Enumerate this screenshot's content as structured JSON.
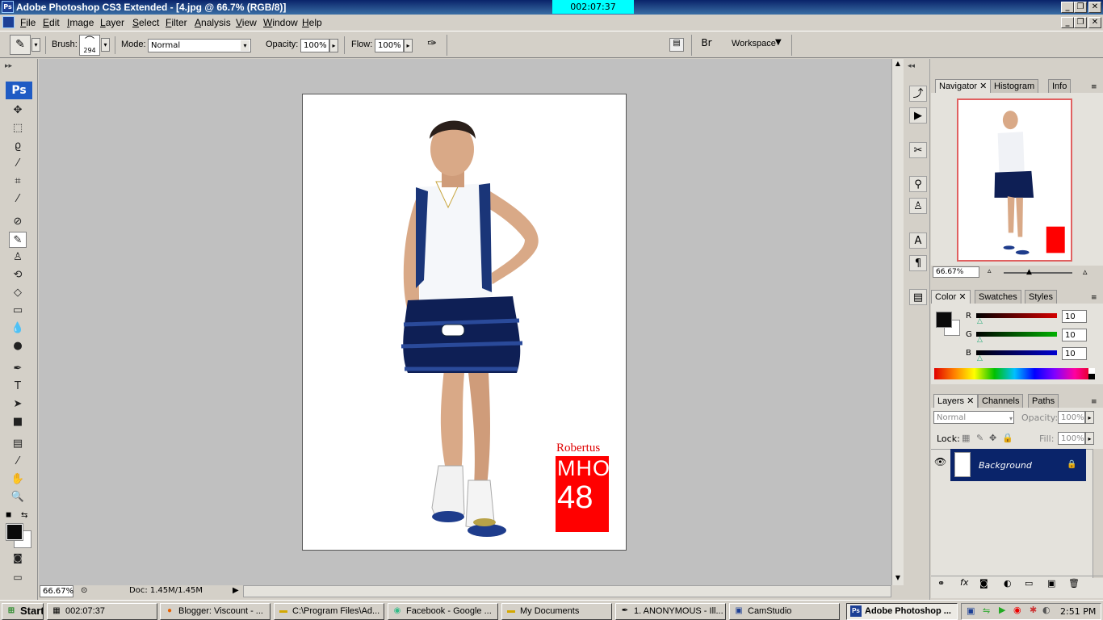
{
  "window": {
    "title": "Adobe Photoshop CS3 Extended - [4.jpg @ 66.7% (RGB/8)]",
    "timer": "002:07:37",
    "app_icon": "Ps"
  },
  "menu": [
    "File",
    "Edit",
    "Image",
    "Layer",
    "Select",
    "Filter",
    "Analysis",
    "View",
    "Window",
    "Help"
  ],
  "options": {
    "brush_label": "Brush:",
    "brush_size": "294",
    "mode_label": "Mode:",
    "mode_value": "Normal",
    "opacity_label": "Opacity:",
    "opacity_value": "100%",
    "flow_label": "Flow:",
    "flow_value": "100%",
    "workspace_label": "Workspace"
  },
  "toolbox": {
    "logo": "Ps",
    "tools": [
      "move-tool-icon",
      "marquee-tool-icon",
      "lasso-tool-icon",
      "magic-wand-icon",
      "crop-tool-icon",
      "eyedropper-icon",
      "healing-brush-icon",
      "brush-tool-icon",
      "clone-stamp-icon",
      "history-brush-icon",
      "eraser-icon",
      "gradient-icon",
      "blur-icon",
      "dodge-icon",
      "pen-tool-icon",
      "type-tool-icon",
      "path-selection-icon",
      "shape-tool-icon",
      "notes-icon",
      "eyedropper-2-icon",
      "hand-tool-icon",
      "zoom-tool-icon"
    ],
    "fg_color": "#0a0a0a",
    "bg_color": "#ffffff"
  },
  "canvas": {
    "watermark_name": "Robertus",
    "watermark_code": "MHO",
    "watermark_number": "48"
  },
  "status": {
    "zoom": "66.67%",
    "doc": "Doc: 1.45M/1.45M"
  },
  "navigator": {
    "tabs": [
      "Navigator",
      "Histogram",
      "Info"
    ],
    "zoom": "66.67%"
  },
  "color_panel": {
    "tabs": [
      "Color",
      "Swatches",
      "Styles"
    ],
    "channels": [
      {
        "label": "R",
        "value": "10",
        "color": "#d40000"
      },
      {
        "label": "G",
        "value": "10",
        "color": "#00b000"
      },
      {
        "label": "B",
        "value": "10",
        "color": "#0000d0"
      }
    ]
  },
  "layers_panel": {
    "tabs": [
      "Layers",
      "Channels",
      "Paths"
    ],
    "blend_mode": "Normal",
    "opacity_label": "Opacity:",
    "opacity_value": "100%",
    "lock_label": "Lock:",
    "fill_label": "Fill:",
    "fill_value": "100%",
    "layer_name": "Background"
  },
  "taskbar": {
    "start": "Start",
    "items": [
      "002:07:37",
      "Blogger: Viscount - ...",
      "C:\\Program Files\\Ad...",
      "Facebook - Google ...",
      "My Documents",
      "1. ANONYMOUS - Ill...",
      "CamStudio",
      "Adobe Photoshop ..."
    ],
    "clock": "2:51 PM"
  }
}
